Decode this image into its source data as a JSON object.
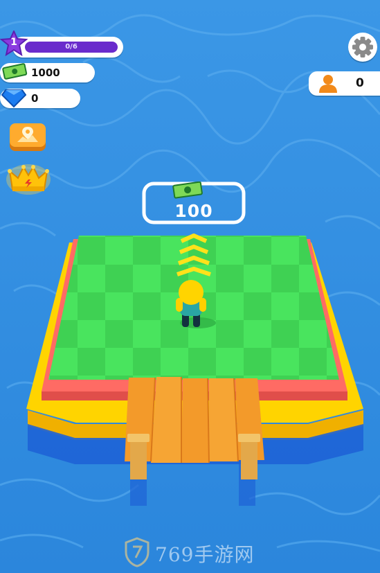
{
  "hud": {
    "level": "1",
    "level_progress_text": "0/6",
    "level_progress": 0,
    "money": "1000",
    "gems": "0",
    "players": "0"
  },
  "world": {
    "zone_price": "100"
  },
  "watermark": {
    "text": "769手游网"
  },
  "colors": {
    "water": "#2f8fe0",
    "grass": "#45e05a",
    "grass_dark": "#3fd153",
    "level_purple": "#6a2bcc",
    "wood": "#f0912a"
  },
  "icons": [
    "level-star-icon",
    "cash-icon",
    "gem-icon",
    "settings-gear-icon",
    "player-icon",
    "map-pin-icon",
    "crown-icon",
    "arrow-up-icon"
  ]
}
